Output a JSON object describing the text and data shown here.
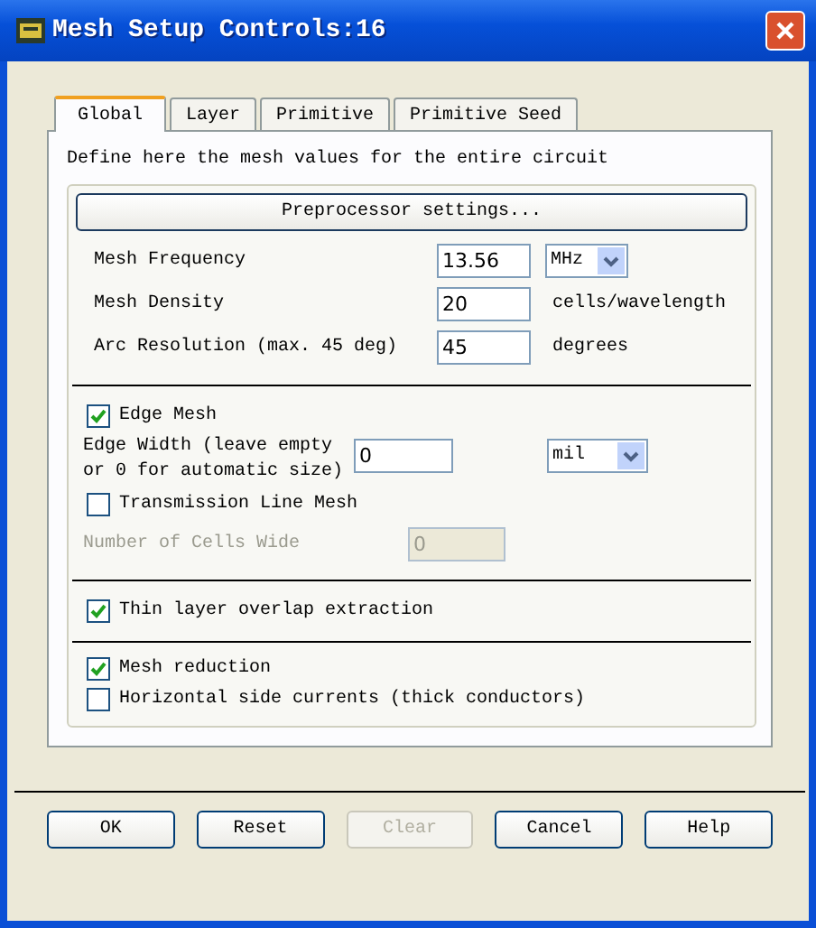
{
  "window": {
    "title": "Mesh Setup Controls:16"
  },
  "tabs": [
    {
      "label": "Global",
      "selected": true
    },
    {
      "label": "Layer",
      "selected": false
    },
    {
      "label": "Primitive",
      "selected": false
    },
    {
      "label": "Primitive Seed",
      "selected": false
    }
  ],
  "description": "Define here the mesh values for the entire circuit",
  "preprocessor_button": "Preprocessor settings...",
  "settings": [
    {
      "label": "Mesh Frequency",
      "value": "13.56",
      "unit": "MHz",
      "kind": "dropdown"
    },
    {
      "label": "Mesh Density",
      "value": "20",
      "unit": "cells/wavelength",
      "kind": "text"
    },
    {
      "label": "Arc Resolution (max. 45 deg)",
      "value": "45",
      "unit": "degrees",
      "kind": "text"
    }
  ],
  "edge_mesh": {
    "label": "Edge Mesh",
    "checked": true,
    "width_label": "Edge Width  (leave empty or 0 for automatic size)",
    "width_value": "0",
    "unit": "mil"
  },
  "transmission_line_mesh": {
    "label": "Transmission Line Mesh",
    "checked": false,
    "cells_label": "Number of Cells Wide",
    "cells_value": "0",
    "disabled": true
  },
  "thin_layer": {
    "label": "Thin layer overlap extraction",
    "checked": true
  },
  "options": [
    {
      "label": "Mesh reduction",
      "checked": true
    },
    {
      "label": "Horizontal side currents (thick conductors)",
      "checked": false
    }
  ],
  "buttons": [
    {
      "label": "OK",
      "disabled": false
    },
    {
      "label": "Reset",
      "disabled": false
    },
    {
      "label": "Clear",
      "disabled": true
    },
    {
      "label": "Cancel",
      "disabled": false
    },
    {
      "label": "Help",
      "disabled": false
    }
  ]
}
